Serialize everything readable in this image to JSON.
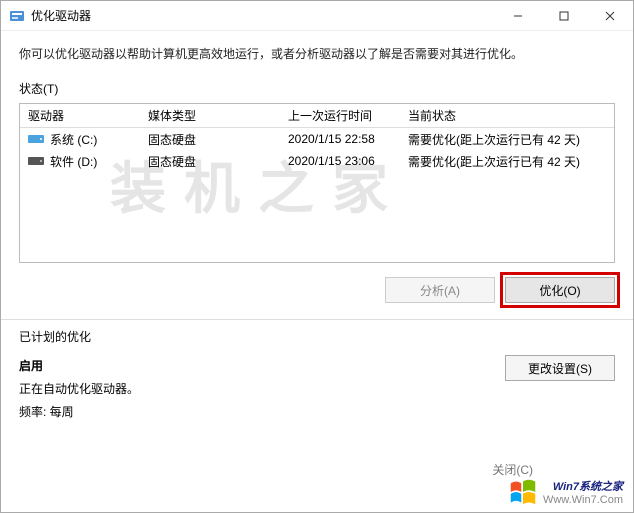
{
  "titlebar": {
    "title": "优化驱动器"
  },
  "description": "你可以优化驱动器以帮助计算机更高效地运行，或者分析驱动器以了解是否需要对其进行优化。",
  "status_label": "状态(T)",
  "columns": {
    "drive": "驱动器",
    "media": "媒体类型",
    "last": "上一次运行时间",
    "state": "当前状态"
  },
  "rows": [
    {
      "icon": "disk-blue",
      "name": "系统 (C:)",
      "media": "固态硬盘",
      "last": "2020/1/15 22:58",
      "state": "需要优化(距上次运行已有 42 天)"
    },
    {
      "icon": "disk-dark",
      "name": "软件 (D:)",
      "media": "固态硬盘",
      "last": "2020/1/15 23:06",
      "state": "需要优化(距上次运行已有 42 天)"
    }
  ],
  "watermark": "装机之家",
  "buttons": {
    "analyze": "分析(A)",
    "optimize": "优化(O)",
    "change": "更改设置(S)",
    "close": "关闭(C)"
  },
  "sched_label": "已计划的优化",
  "sched": {
    "heading": "启用",
    "line1": "正在自动优化驱动器。",
    "line2": "频率: 每周"
  },
  "brand": {
    "name": "Win7系统之家",
    "url": "Www.Win7.Com"
  }
}
